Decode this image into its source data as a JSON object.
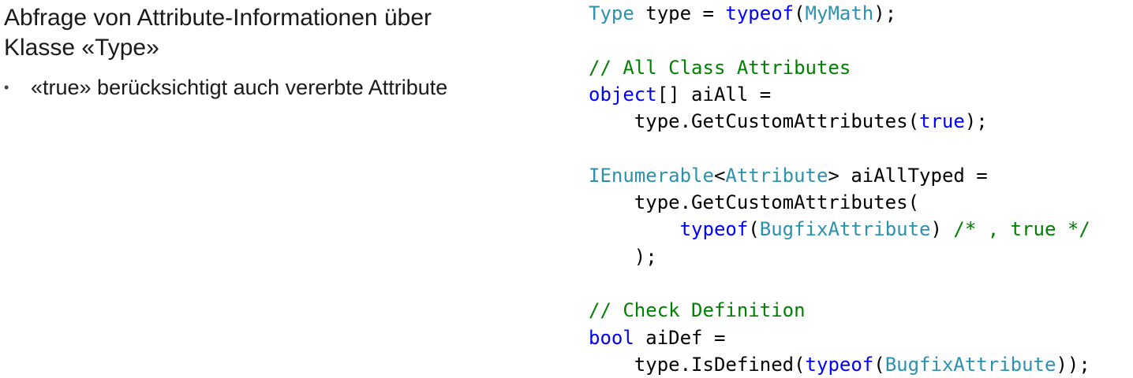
{
  "left": {
    "title_line1": "Abfrage von Attribute-Informationen über",
    "title_line2": "Klasse «Type»",
    "bullets": [
      {
        "marker": "•",
        "text": "«true» berücksichtigt auch vererbte Attribute"
      }
    ]
  },
  "code": {
    "colors": {
      "type": "#2b91af",
      "keyword": "#0000ff",
      "comment": "#008000",
      "plain": "#000000"
    },
    "lines": [
      [
        {
          "k": "type",
          "t": "Type"
        },
        {
          "k": "pl",
          "t": " type = "
        },
        {
          "k": "kw",
          "t": "typeof"
        },
        {
          "k": "pl",
          "t": "("
        },
        {
          "k": "type",
          "t": "MyMath"
        },
        {
          "k": "pl",
          "t": ");"
        }
      ],
      [],
      [
        {
          "k": "cm",
          "t": "// All Class Attributes"
        }
      ],
      [
        {
          "k": "kw",
          "t": "object"
        },
        {
          "k": "pl",
          "t": "[] aiAll ="
        }
      ],
      [
        {
          "k": "pl",
          "t": "    type.GetCustomAttributes("
        },
        {
          "k": "kw",
          "t": "true"
        },
        {
          "k": "pl",
          "t": ");"
        }
      ],
      [],
      [
        {
          "k": "type",
          "t": "IEnumerable"
        },
        {
          "k": "pl",
          "t": "<"
        },
        {
          "k": "type",
          "t": "Attribute"
        },
        {
          "k": "pl",
          "t": "> aiAllTyped ="
        }
      ],
      [
        {
          "k": "pl",
          "t": "    type.GetCustomAttributes("
        }
      ],
      [
        {
          "k": "pl",
          "t": "        "
        },
        {
          "k": "kw",
          "t": "typeof"
        },
        {
          "k": "pl",
          "t": "("
        },
        {
          "k": "type",
          "t": "BugfixAttribute"
        },
        {
          "k": "pl",
          "t": ") "
        },
        {
          "k": "cm",
          "t": "/* , true */"
        }
      ],
      [
        {
          "k": "pl",
          "t": "    );"
        }
      ],
      [],
      [
        {
          "k": "cm",
          "t": "// Check Definition"
        }
      ],
      [
        {
          "k": "kw",
          "t": "bool"
        },
        {
          "k": "pl",
          "t": " aiDef ="
        }
      ],
      [
        {
          "k": "pl",
          "t": "    type.IsDefined("
        },
        {
          "k": "kw",
          "t": "typeof"
        },
        {
          "k": "pl",
          "t": "("
        },
        {
          "k": "type",
          "t": "BugfixAttribute"
        },
        {
          "k": "pl",
          "t": "));"
        }
      ]
    ]
  }
}
